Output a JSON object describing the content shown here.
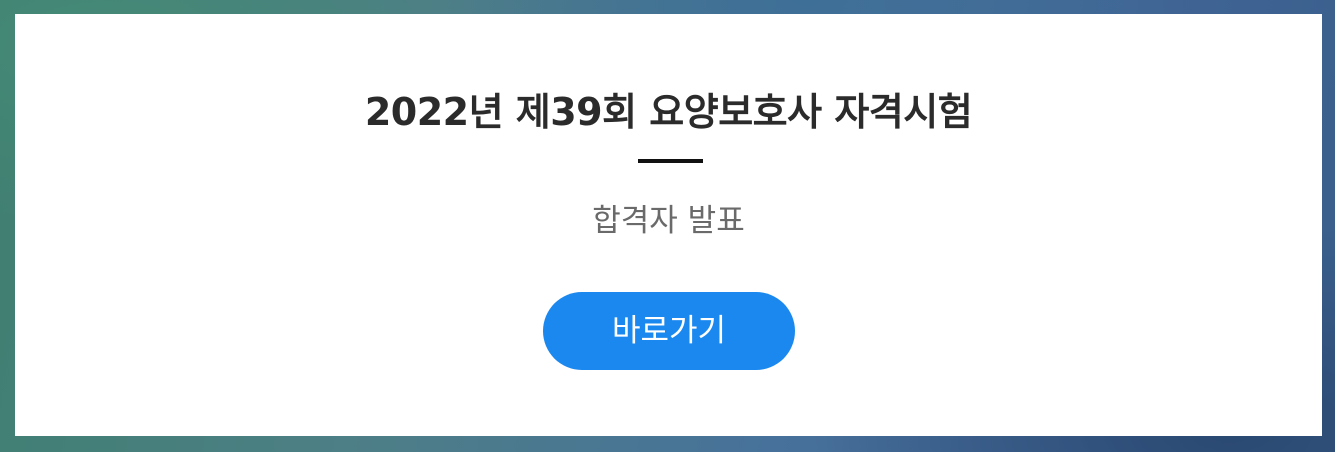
{
  "popup": {
    "title": "2022년 제39회 요양보호사 자격시험",
    "subtitle": "합격자 발표",
    "button_label": "바로가기"
  },
  "colors": {
    "button_background": "#1a88ee",
    "title_text": "#2b2b2b",
    "subtitle_text": "#6a6a6a",
    "divider": "#111111"
  }
}
